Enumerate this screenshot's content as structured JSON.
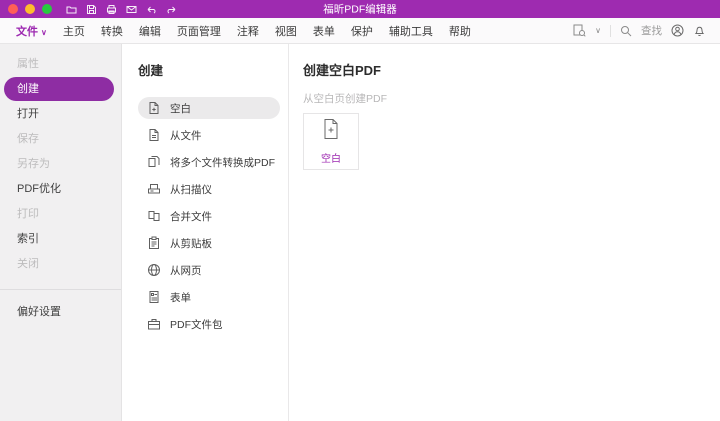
{
  "titlebar": {
    "title": "福昕PDF编辑器"
  },
  "menubar": {
    "items": [
      {
        "label": "文件",
        "chevron": "∨"
      },
      {
        "label": "主页"
      },
      {
        "label": "转换"
      },
      {
        "label": "编辑"
      },
      {
        "label": "页面管理"
      },
      {
        "label": "注释"
      },
      {
        "label": "视图"
      },
      {
        "label": "表单"
      },
      {
        "label": "保护"
      },
      {
        "label": "辅助工具"
      },
      {
        "label": "帮助"
      }
    ],
    "find_label": "查找"
  },
  "sidebar": {
    "items": [
      {
        "label": "属性",
        "state": "disabled"
      },
      {
        "label": "创建",
        "state": "selected"
      },
      {
        "label": "打开",
        "state": "normal"
      },
      {
        "label": "保存",
        "state": "disabled"
      },
      {
        "label": "另存为",
        "state": "disabled"
      },
      {
        "label": "PDF优化",
        "state": "normal"
      },
      {
        "label": "打印",
        "state": "disabled"
      },
      {
        "label": "索引",
        "state": "normal"
      },
      {
        "label": "关闭",
        "state": "disabled"
      }
    ],
    "preferences_label": "偏好设置"
  },
  "create_panel": {
    "title": "创建",
    "items": [
      {
        "label": "空白",
        "icon": "blank-doc-icon",
        "selected": true
      },
      {
        "label": "从文件",
        "icon": "from-file-icon"
      },
      {
        "label": "将多个文件转换成PDF",
        "icon": "multi-file-convert-icon"
      },
      {
        "label": "从扫描仪",
        "icon": "scanner-icon"
      },
      {
        "label": "合并文件",
        "icon": "combine-files-icon"
      },
      {
        "label": "从剪贴板",
        "icon": "clipboard-icon"
      },
      {
        "label": "从网页",
        "icon": "web-page-icon"
      },
      {
        "label": "表单",
        "icon": "form-icon"
      },
      {
        "label": "PDF文件包",
        "icon": "pdf-portfolio-icon"
      }
    ]
  },
  "detail_panel": {
    "title": "创建空白PDF",
    "subtitle": "从空白页创建PDF",
    "card_label": "空白"
  },
  "colors": {
    "titlebar": "#9e2bb0",
    "accent": "#9c27b0",
    "sidebar_selected": "#8e2da3"
  }
}
